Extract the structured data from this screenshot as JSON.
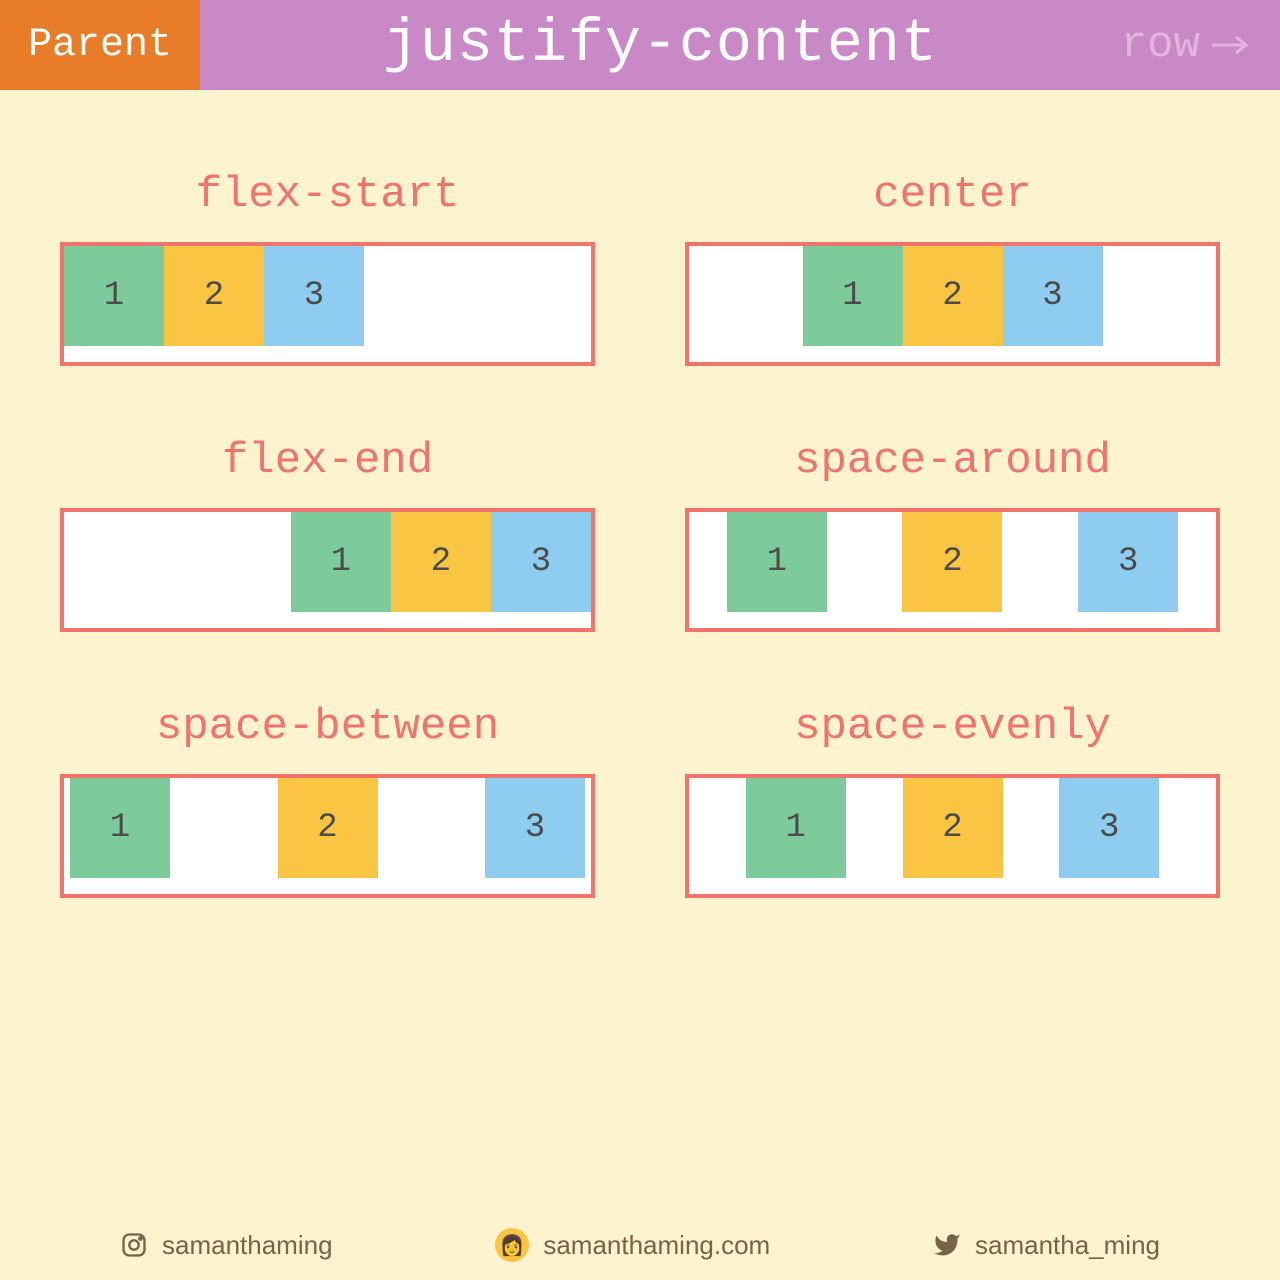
{
  "header": {
    "parent_tag": "Parent",
    "title": "justify-content",
    "direction": "row"
  },
  "examples": [
    {
      "label": "flex-start",
      "class": "flex-start"
    },
    {
      "label": "center",
      "class": "center"
    },
    {
      "label": "flex-end",
      "class": "flex-end"
    },
    {
      "label": "space-around",
      "class": "space-around"
    },
    {
      "label": "space-between",
      "class": "space-between"
    },
    {
      "label": "space-evenly",
      "class": "space-evenly"
    }
  ],
  "boxes": [
    "1",
    "2",
    "3"
  ],
  "footer": {
    "instagram": "samanthaming",
    "website": "samanthaming.com",
    "twitter": "samantha_ming"
  },
  "colors": {
    "accent": "#f0736c",
    "bg": "#fdf3cf",
    "header_bg": "#c989c6",
    "parent_bg": "#e87c28",
    "box1": "#7dcb9a",
    "box2": "#f9c543",
    "box3": "#8ecdf0"
  }
}
